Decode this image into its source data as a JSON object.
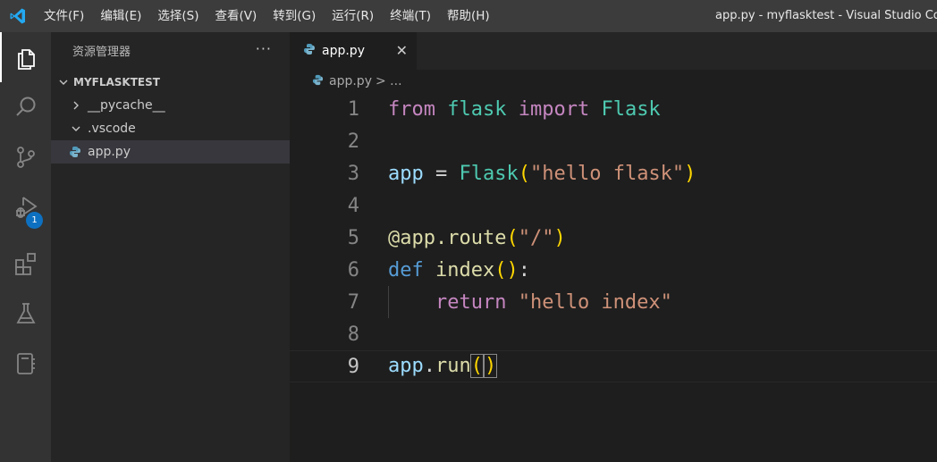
{
  "menu": [
    "文件(F)",
    "编辑(E)",
    "选择(S)",
    "查看(V)",
    "转到(G)",
    "运行(R)",
    "终端(T)",
    "帮助(H)"
  ],
  "window_title": "app.py - myflasktest - Visual Studio Code",
  "activity": {
    "icons": [
      "explorer-icon",
      "search-icon",
      "source-control-icon",
      "run-debug-icon",
      "extensions-icon",
      "testing-icon",
      "notebook-icon"
    ],
    "debug_badge": "1"
  },
  "explorer": {
    "title": "资源管理器",
    "more": "···",
    "project": "MYFLASKTEST",
    "items": [
      {
        "label": "__pycache__",
        "type": "folder-collapsed"
      },
      {
        "label": ".vscode",
        "type": "folder-expanded"
      },
      {
        "label": "app.py",
        "type": "python-file"
      }
    ]
  },
  "editor": {
    "tab_label": "app.py",
    "tab_close": "✕",
    "breadcrumb_file": "app.py",
    "breadcrumb_rest": "> ...",
    "line_numbers": [
      "1",
      "2",
      "3",
      "4",
      "5",
      "6",
      "7",
      "8",
      "9"
    ],
    "tokens": {
      "l1": [
        "from",
        "flask",
        "import",
        "Flask"
      ],
      "l3": [
        "app",
        " = ",
        "Flask",
        "(",
        "\"hello flask\"",
        ")"
      ],
      "l5": [
        "@app.route",
        "(",
        "\"/\"",
        ")"
      ],
      "l6": [
        "def",
        "index",
        "()",
        ":"
      ],
      "l7": [
        "return",
        "\"hello index\""
      ],
      "l9": [
        "app",
        ".",
        "run",
        "(",
        ")"
      ]
    }
  },
  "colors": {
    "keyword": "#c586c0",
    "module": "#4ec9b0",
    "variable": "#9cdcfe",
    "function": "#dcdcaa",
    "string": "#ce9178",
    "def": "#569cd6",
    "bracket": "#ffd700"
  }
}
